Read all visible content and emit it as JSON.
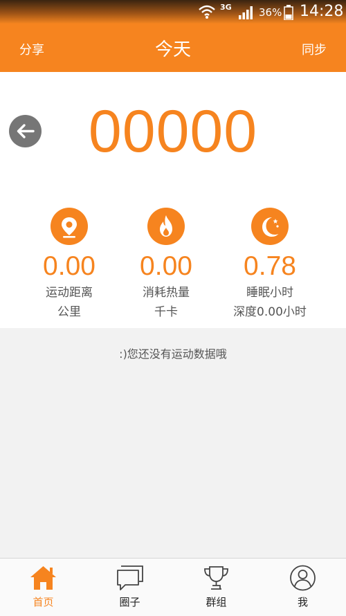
{
  "status_bar": {
    "network": "3G",
    "battery": "36%",
    "time": "14:28"
  },
  "app_bar": {
    "left_action": "分享",
    "title": "今天",
    "right_action": "同步"
  },
  "steps": "00000",
  "stats": {
    "distance": {
      "value": "0.00",
      "label": "运动距离",
      "unit": "公里"
    },
    "calories": {
      "value": "0.00",
      "label": "消耗热量",
      "unit": "千卡"
    },
    "sleep": {
      "value": "0.78",
      "label": "睡眠小时",
      "sub": "深度0.00小时"
    }
  },
  "empty_message": ":)您还没有运动数据哦",
  "tabs": [
    {
      "label": "首页",
      "icon": "home-icon",
      "active": true
    },
    {
      "label": "圈子",
      "icon": "chat-icon",
      "active": false
    },
    {
      "label": "群组",
      "icon": "trophy-icon",
      "active": false
    },
    {
      "label": "我",
      "icon": "profile-icon",
      "active": false
    }
  ],
  "colors": {
    "accent": "#f6841f",
    "back_button": "#767676",
    "background": "#f2f2f2"
  }
}
